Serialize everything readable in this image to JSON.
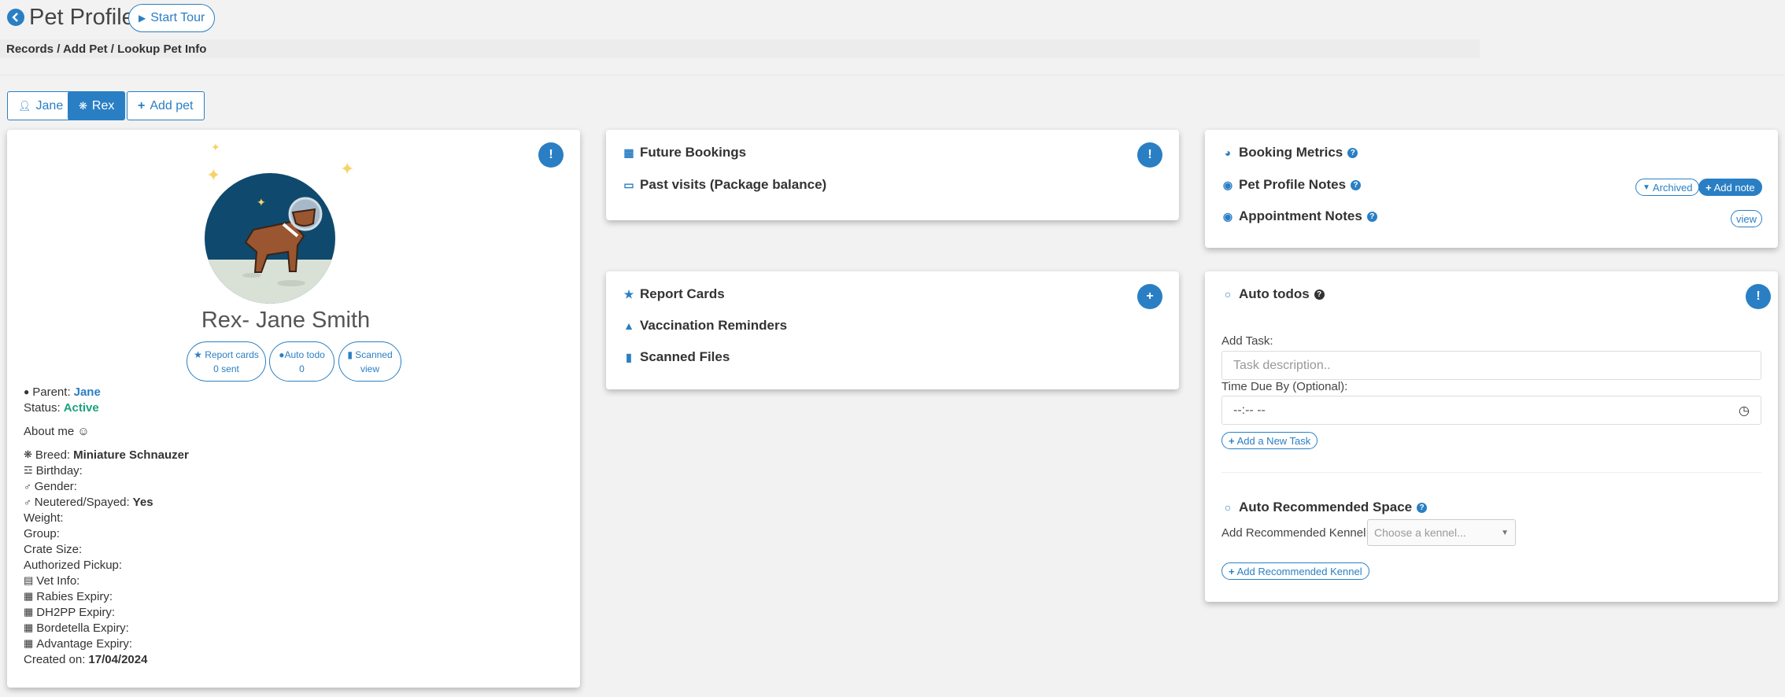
{
  "header": {
    "title": "Pet Profile",
    "tour_label": "Start Tour",
    "breadcrumb": "Records / Add Pet / Lookup Pet Info"
  },
  "tabs": [
    {
      "label": "Jane",
      "icon": "user-icon"
    },
    {
      "label": "Rex",
      "icon": "paw-icon"
    },
    {
      "label": "Add pet",
      "icon": "plus-icon"
    }
  ],
  "profile": {
    "name": "Rex- Jane Smith",
    "stats": [
      {
        "label": "Report cards",
        "value": "0 sent",
        "icon": "star-icon"
      },
      {
        "label": "Auto todo",
        "value": "0",
        "icon": "bulb-icon"
      },
      {
        "label": "Scanned",
        "value": "view",
        "icon": "file-icon"
      }
    ],
    "parent_label": "Parent:",
    "parent_value": "Jane",
    "status_label": "Status:",
    "status_value": "Active",
    "about_label": "About me ☺",
    "fields": [
      {
        "label": "Breed:",
        "value": "Miniature Schnauzer",
        "icon": "paw-icon"
      },
      {
        "label": "Birthday:",
        "value": "",
        "icon": "cake-icon"
      },
      {
        "label": "Gender:",
        "value": "",
        "icon": "male-icon"
      },
      {
        "label": "Neutered/Spayed:",
        "value": "Yes",
        "icon": "male-icon"
      },
      {
        "label": "Weight:",
        "value": "",
        "icon": ""
      },
      {
        "label": "Group:",
        "value": "",
        "icon": ""
      },
      {
        "label": "Crate Size:",
        "value": "",
        "icon": ""
      },
      {
        "label": "Authorized Pickup:",
        "value": "",
        "icon": ""
      },
      {
        "label": "Vet Info:",
        "value": "",
        "icon": "clipboard-icon"
      },
      {
        "label": "Rabies Expiry:",
        "value": "",
        "icon": "calendar-icon"
      },
      {
        "label": "DH2PP Expiry:",
        "value": "",
        "icon": "calendar-icon"
      },
      {
        "label": "Bordetella Expiry:",
        "value": "",
        "icon": "calendar-icon"
      },
      {
        "label": "Advantage Expiry:",
        "value": "",
        "icon": "calendar-icon"
      },
      {
        "label": "Created on:",
        "value": "17/04/2024",
        "icon": ""
      }
    ]
  },
  "bookings": {
    "future_label": "Future Bookings",
    "past_label": "Past visits (Package balance)"
  },
  "reports": {
    "report_cards_label": "Report Cards",
    "vaccination_label": "Vaccination Reminders",
    "scanned_label": "Scanned Files"
  },
  "metrics": {
    "booking_metrics_label": "Booking Metrics",
    "pet_notes_label": "Pet Profile Notes",
    "archived_label": "Archived",
    "add_note_label": "Add note",
    "appt_notes_label": "Appointment Notes",
    "view_label": "view"
  },
  "todos": {
    "title": "Auto todos",
    "add_task_label": "Add Task:",
    "task_placeholder": "Task description..",
    "due_label": "Time Due By (Optional):",
    "time_placeholder": "--:-- --",
    "add_task_button": "Add a New Task",
    "space_title": "Auto Recommended Space",
    "kennel_label": "Add Recommended Kennel:",
    "kennel_placeholder": "Choose a kennel...",
    "add_kennel_button": "Add Recommended Kennel"
  },
  "colors": {
    "accent": "#2a7fc4",
    "active_status": "#1aa37a",
    "background": "#f2f2f2"
  }
}
